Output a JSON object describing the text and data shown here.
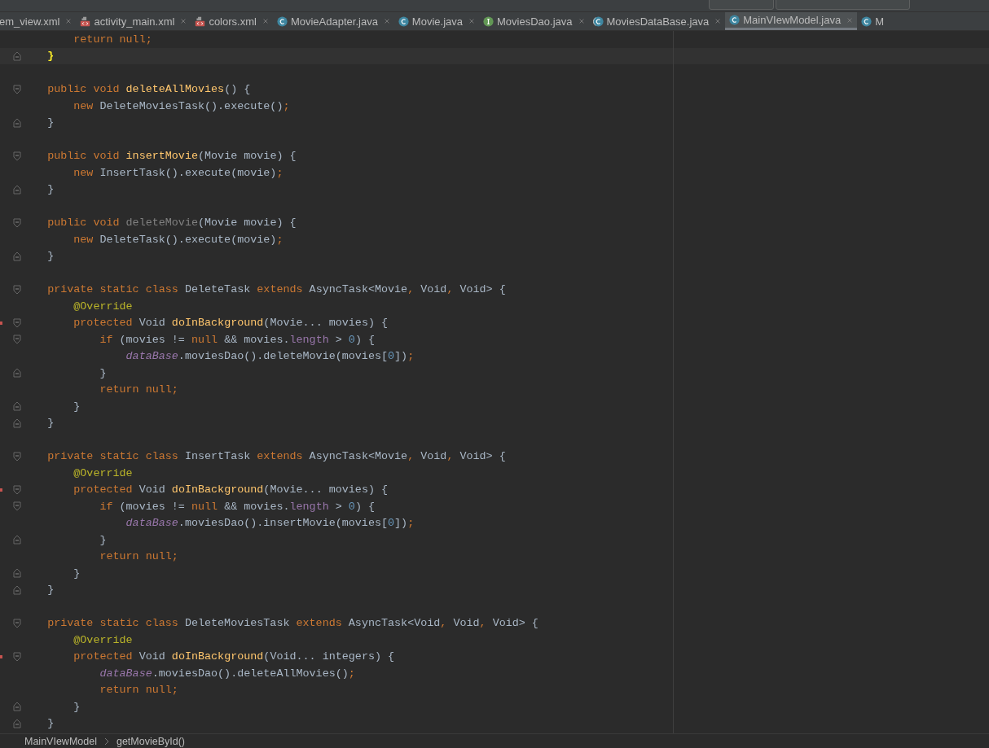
{
  "tabs": [
    {
      "label": "em_view.xml",
      "kind": "plain",
      "selected": false
    },
    {
      "label": "activity_main.xml",
      "kind": "xml",
      "selected": false
    },
    {
      "label": "colors.xml",
      "kind": "xml",
      "selected": false
    },
    {
      "label": "MovieAdapter.java",
      "kind": "class",
      "selected": false
    },
    {
      "label": "Movie.java",
      "kind": "class",
      "selected": false
    },
    {
      "label": "MoviesDao.java",
      "kind": "interface",
      "selected": false
    },
    {
      "label": "MoviesDataBase.java",
      "kind": "abstract",
      "selected": false
    },
    {
      "label": "MainVIewModel.java",
      "kind": "class",
      "selected": true
    },
    {
      "label": "M",
      "kind": "class",
      "selected": false
    }
  ],
  "editor": {
    "lines": [
      {
        "kind": "plain",
        "tokens": [
          {
            "text": "        return null",
            "kind": "kw"
          },
          {
            "text": ";",
            "kind": "kw"
          }
        ]
      },
      {
        "kind": "closer",
        "current": true,
        "tokens": [
          {
            "text": "    }",
            "kind": "match"
          }
        ]
      },
      {
        "kind": "blank"
      },
      {
        "kind": "opener",
        "tokens": [
          {
            "text": "    public void ",
            "kind": "kw"
          },
          {
            "text": "deleteAllMovies",
            "kind": "method"
          },
          {
            "text": "() {",
            "kind": "plain"
          }
        ]
      },
      {
        "kind": "plain",
        "tokens": [
          {
            "text": "        new ",
            "kind": "kw"
          },
          {
            "text": "DeleteMoviesTask().execute()",
            "kind": "plain"
          },
          {
            "text": ";",
            "kind": "kw"
          }
        ]
      },
      {
        "kind": "closer",
        "tokens": [
          {
            "text": "    }",
            "kind": "plain"
          }
        ]
      },
      {
        "kind": "blank"
      },
      {
        "kind": "opener",
        "tokens": [
          {
            "text": "    public void ",
            "kind": "kw"
          },
          {
            "text": "insertMovie",
            "kind": "method"
          },
          {
            "text": "(Movie movie) {",
            "kind": "plain"
          }
        ]
      },
      {
        "kind": "plain",
        "tokens": [
          {
            "text": "        new ",
            "kind": "kw"
          },
          {
            "text": "InsertTask().execute(movie)",
            "kind": "plain"
          },
          {
            "text": ";",
            "kind": "kw"
          }
        ]
      },
      {
        "kind": "closer",
        "tokens": [
          {
            "text": "    }",
            "kind": "plain"
          }
        ]
      },
      {
        "kind": "blank"
      },
      {
        "kind": "opener",
        "tokens": [
          {
            "text": "    public void ",
            "kind": "kw"
          },
          {
            "text": "deleteMovie",
            "kind": "unused"
          },
          {
            "text": "(Movie movie) {",
            "kind": "plain"
          }
        ]
      },
      {
        "kind": "plain",
        "tokens": [
          {
            "text": "        new ",
            "kind": "kw"
          },
          {
            "text": "DeleteTask().execute(movie)",
            "kind": "plain"
          },
          {
            "text": ";",
            "kind": "kw"
          }
        ]
      },
      {
        "kind": "closer",
        "tokens": [
          {
            "text": "    }",
            "kind": "plain"
          }
        ]
      },
      {
        "kind": "blank"
      },
      {
        "kind": "opener",
        "tokens": [
          {
            "text": "    private static class ",
            "kind": "kw"
          },
          {
            "text": "DeleteTask ",
            "kind": "plain"
          },
          {
            "text": "extends ",
            "kind": "kw"
          },
          {
            "text": "AsyncTask<Movie",
            "kind": "plain"
          },
          {
            "text": ", ",
            "kind": "kw"
          },
          {
            "text": "Void",
            "kind": "plain"
          },
          {
            "text": ", ",
            "kind": "kw"
          },
          {
            "text": "Void> {",
            "kind": "plain"
          }
        ]
      },
      {
        "kind": "plain",
        "tokens": [
          {
            "text": "        @Override",
            "kind": "annotation"
          }
        ]
      },
      {
        "kind": "opener",
        "marker": true,
        "tokens": [
          {
            "text": "        protected ",
            "kind": "kw"
          },
          {
            "text": "Void ",
            "kind": "plain"
          },
          {
            "text": "doInBackground",
            "kind": "method"
          },
          {
            "text": "(Movie... movies) {",
            "kind": "plain"
          }
        ]
      },
      {
        "kind": "opener",
        "tokens": [
          {
            "text": "            if ",
            "kind": "kw"
          },
          {
            "text": "(movies != ",
            "kind": "plain"
          },
          {
            "text": "null ",
            "kind": "kw"
          },
          {
            "text": "&& movies.",
            "kind": "plain"
          },
          {
            "text": "length",
            "kind": "field"
          },
          {
            "text": " > ",
            "kind": "plain"
          },
          {
            "text": "0",
            "kind": "number"
          },
          {
            "text": ") {",
            "kind": "plain"
          }
        ]
      },
      {
        "kind": "plain",
        "tokens": [
          {
            "text": "                dataBase",
            "kind": "static"
          },
          {
            "text": ".moviesDao().deleteMovie(movies[",
            "kind": "plain"
          },
          {
            "text": "0",
            "kind": "number"
          },
          {
            "text": "])",
            "kind": "plain"
          },
          {
            "text": ";",
            "kind": "kw"
          }
        ]
      },
      {
        "kind": "closer",
        "tokens": [
          {
            "text": "            }",
            "kind": "plain"
          }
        ]
      },
      {
        "kind": "plain",
        "tokens": [
          {
            "text": "            return null",
            "kind": "kw"
          },
          {
            "text": ";",
            "kind": "kw"
          }
        ]
      },
      {
        "kind": "closer",
        "tokens": [
          {
            "text": "        }",
            "kind": "plain"
          }
        ]
      },
      {
        "kind": "closer",
        "tokens": [
          {
            "text": "    }",
            "kind": "plain"
          }
        ]
      },
      {
        "kind": "blank"
      },
      {
        "kind": "opener",
        "tokens": [
          {
            "text": "    private static class ",
            "kind": "kw"
          },
          {
            "text": "InsertTask ",
            "kind": "plain"
          },
          {
            "text": "extends ",
            "kind": "kw"
          },
          {
            "text": "AsyncTask<Movie",
            "kind": "plain"
          },
          {
            "text": ", ",
            "kind": "kw"
          },
          {
            "text": "Void",
            "kind": "plain"
          },
          {
            "text": ", ",
            "kind": "kw"
          },
          {
            "text": "Void> {",
            "kind": "plain"
          }
        ]
      },
      {
        "kind": "plain",
        "tokens": [
          {
            "text": "        @Override",
            "kind": "annotation"
          }
        ]
      },
      {
        "kind": "opener",
        "marker": true,
        "tokens": [
          {
            "text": "        protected ",
            "kind": "kw"
          },
          {
            "text": "Void ",
            "kind": "plain"
          },
          {
            "text": "doInBackground",
            "kind": "method"
          },
          {
            "text": "(Movie... movies) {",
            "kind": "plain"
          }
        ]
      },
      {
        "kind": "opener",
        "tokens": [
          {
            "text": "            if ",
            "kind": "kw"
          },
          {
            "text": "(movies != ",
            "kind": "plain"
          },
          {
            "text": "null ",
            "kind": "kw"
          },
          {
            "text": "&& movies.",
            "kind": "plain"
          },
          {
            "text": "length",
            "kind": "field"
          },
          {
            "text": " > ",
            "kind": "plain"
          },
          {
            "text": "0",
            "kind": "number"
          },
          {
            "text": ") {",
            "kind": "plain"
          }
        ]
      },
      {
        "kind": "plain",
        "tokens": [
          {
            "text": "                dataBase",
            "kind": "static"
          },
          {
            "text": ".moviesDao().insertMovie(movies[",
            "kind": "plain"
          },
          {
            "text": "0",
            "kind": "number"
          },
          {
            "text": "])",
            "kind": "plain"
          },
          {
            "text": ";",
            "kind": "kw"
          }
        ]
      },
      {
        "kind": "closer",
        "tokens": [
          {
            "text": "            }",
            "kind": "plain"
          }
        ]
      },
      {
        "kind": "plain",
        "tokens": [
          {
            "text": "            return null",
            "kind": "kw"
          },
          {
            "text": ";",
            "kind": "kw"
          }
        ]
      },
      {
        "kind": "closer",
        "tokens": [
          {
            "text": "        }",
            "kind": "plain"
          }
        ]
      },
      {
        "kind": "closer",
        "tokens": [
          {
            "text": "    }",
            "kind": "plain"
          }
        ]
      },
      {
        "kind": "blank"
      },
      {
        "kind": "opener",
        "tokens": [
          {
            "text": "    private static class ",
            "kind": "kw"
          },
          {
            "text": "DeleteMoviesTask ",
            "kind": "plain"
          },
          {
            "text": "extends ",
            "kind": "kw"
          },
          {
            "text": "AsyncTask<Void",
            "kind": "plain"
          },
          {
            "text": ", ",
            "kind": "kw"
          },
          {
            "text": "Void",
            "kind": "plain"
          },
          {
            "text": ", ",
            "kind": "kw"
          },
          {
            "text": "Void> {",
            "kind": "plain"
          }
        ]
      },
      {
        "kind": "plain",
        "tokens": [
          {
            "text": "        @Override",
            "kind": "annotation"
          }
        ]
      },
      {
        "kind": "opener",
        "marker": true,
        "tokens": [
          {
            "text": "        protected ",
            "kind": "kw"
          },
          {
            "text": "Void ",
            "kind": "plain"
          },
          {
            "text": "doInBackground",
            "kind": "method"
          },
          {
            "text": "(Void... integers) {",
            "kind": "plain"
          }
        ]
      },
      {
        "kind": "plain",
        "tokens": [
          {
            "text": "            dataBase",
            "kind": "static"
          },
          {
            "text": ".moviesDao().deleteAllMovies()",
            "kind": "plain"
          },
          {
            "text": ";",
            "kind": "kw"
          }
        ]
      },
      {
        "kind": "plain",
        "tokens": [
          {
            "text": "            return null",
            "kind": "kw"
          },
          {
            "text": ";",
            "kind": "kw"
          }
        ]
      },
      {
        "kind": "closer",
        "tokens": [
          {
            "text": "        }",
            "kind": "plain"
          }
        ]
      },
      {
        "kind": "closer",
        "tokens": [
          {
            "text": "    }",
            "kind": "plain"
          }
        ]
      }
    ]
  },
  "breadcrumb": [
    "MainVIewModel",
    "getMovieById()"
  ]
}
